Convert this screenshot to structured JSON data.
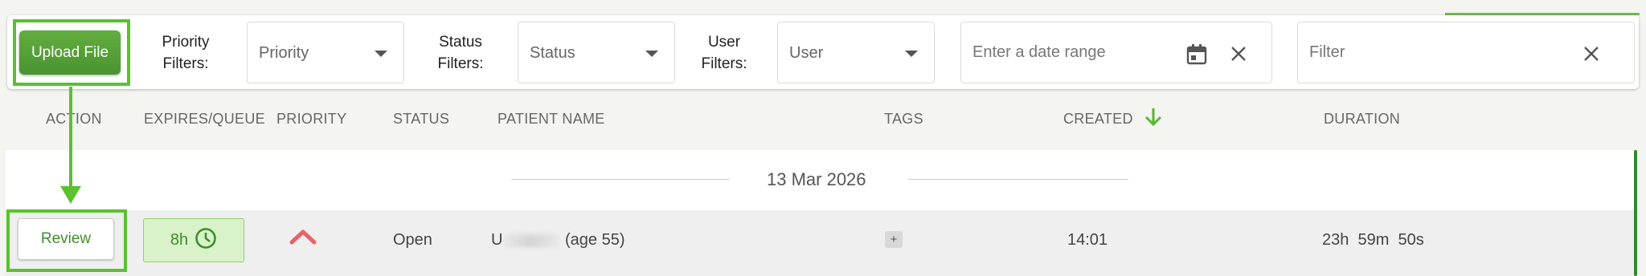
{
  "toolbar": {
    "upload_label": "Upload File",
    "priority": {
      "label_line1": "Priority",
      "label_line2": "Filters:",
      "value": "Priority"
    },
    "status": {
      "label_line1": "Status",
      "label_line2": "Filters:",
      "value": "Status"
    },
    "user": {
      "label_line1": "User",
      "label_line2": "Filters:",
      "value": "User"
    },
    "date_range": {
      "placeholder": "Enter a date range",
      "value": ""
    },
    "filter": {
      "placeholder": "Filter",
      "value": ""
    }
  },
  "table": {
    "columns": [
      "ACTION",
      "EXPIRES/QUEUE",
      "PRIORITY",
      "STATUS",
      "PATIENT NAME",
      "TAGS",
      "CREATED",
      "DURATION"
    ],
    "sort": {
      "column": "CREATED",
      "direction": "descending"
    },
    "groups": [
      {
        "date": "13 Mar 2026",
        "rows": [
          {
            "action": "Review",
            "expires": "8h",
            "priority": "high",
            "status": "Open",
            "patient_initial": "U",
            "patient_age": "(age 55)",
            "tag_add": "+",
            "created": "14:01",
            "duration": "23h  59m  50s"
          }
        ]
      }
    ]
  },
  "colors": {
    "brand_green": "#4e9a34",
    "annotation_green": "#59c22e",
    "priority_high": "#e8616a",
    "badge_bg": "#d9f2c9"
  },
  "icons": {
    "date": "calendar-icon",
    "clear": "close-icon",
    "caret": "chevron-down-icon",
    "sort": "arrow-down-icon",
    "priority": "chevron-up-icon",
    "expires": "clock-icon"
  }
}
